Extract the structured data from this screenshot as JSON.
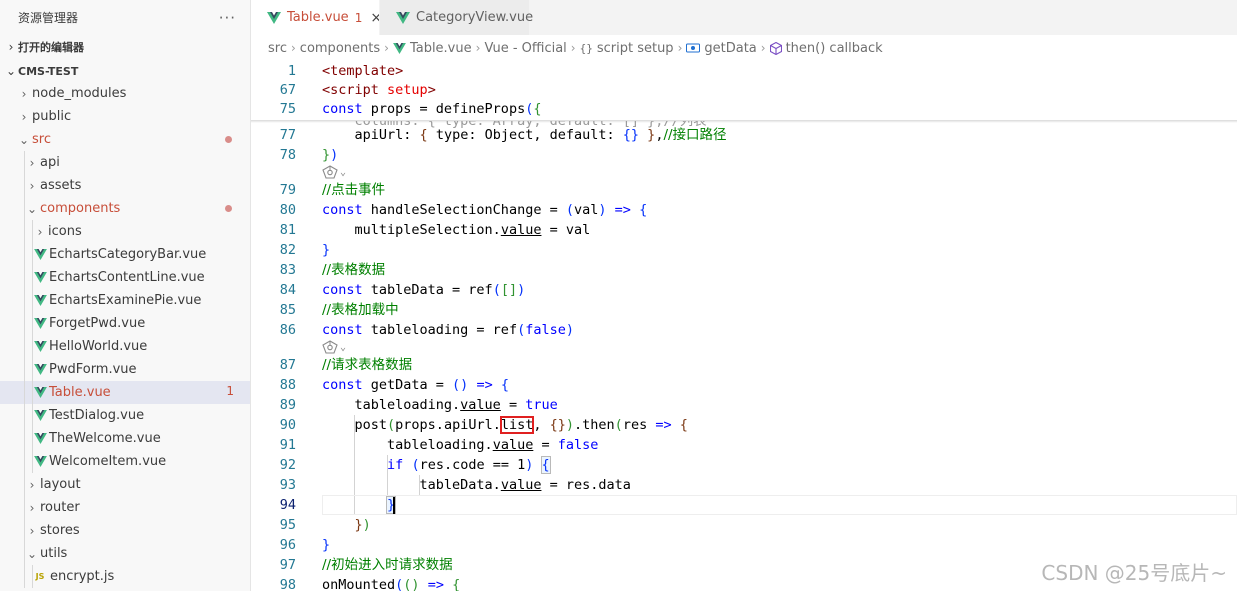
{
  "sidebar": {
    "title": "资源管理器",
    "more": "···",
    "open_editors": "打开的编辑器",
    "project": "CMS-TEST",
    "items": [
      {
        "label": "node_modules",
        "type": "folder",
        "depth": 0,
        "open": false
      },
      {
        "label": "public",
        "type": "folder",
        "depth": 0,
        "open": false
      },
      {
        "label": "src",
        "type": "folder",
        "depth": 0,
        "open": true,
        "modified": true
      },
      {
        "label": "api",
        "type": "folder",
        "depth": 1,
        "open": false
      },
      {
        "label": "assets",
        "type": "folder",
        "depth": 1,
        "open": false
      },
      {
        "label": "components",
        "type": "folder",
        "depth": 1,
        "open": true,
        "modified": true
      },
      {
        "label": "icons",
        "type": "folder",
        "depth": 2,
        "open": false
      },
      {
        "label": "EchartsCategoryBar.vue",
        "type": "vue",
        "depth": 2
      },
      {
        "label": "EchartsContentLine.vue",
        "type": "vue",
        "depth": 2
      },
      {
        "label": "EchartsExaminePie.vue",
        "type": "vue",
        "depth": 2
      },
      {
        "label": "ForgetPwd.vue",
        "type": "vue",
        "depth": 2
      },
      {
        "label": "HelloWorld.vue",
        "type": "vue",
        "depth": 2
      },
      {
        "label": "PwdForm.vue",
        "type": "vue",
        "depth": 2
      },
      {
        "label": "Table.vue",
        "type": "vue",
        "depth": 2,
        "selected": true,
        "modified": true,
        "badge": "1"
      },
      {
        "label": "TestDialog.vue",
        "type": "vue",
        "depth": 2
      },
      {
        "label": "TheWelcome.vue",
        "type": "vue",
        "depth": 2
      },
      {
        "label": "WelcomeItem.vue",
        "type": "vue",
        "depth": 2
      },
      {
        "label": "layout",
        "type": "folder",
        "depth": 1,
        "open": false
      },
      {
        "label": "router",
        "type": "folder",
        "depth": 1,
        "open": false
      },
      {
        "label": "stores",
        "type": "folder",
        "depth": 1,
        "open": false
      },
      {
        "label": "utils",
        "type": "folder",
        "depth": 1,
        "open": true
      },
      {
        "label": "encrypt.js",
        "type": "js",
        "depth": 2
      }
    ]
  },
  "tabs": [
    {
      "label": "Table.vue",
      "badge": "1",
      "close": "×",
      "active": true
    },
    {
      "label": "CategoryView.vue",
      "active": false
    }
  ],
  "breadcrumb": {
    "items": [
      "src",
      "components",
      "Table.vue",
      "Vue - Official",
      "script setup",
      "getData",
      "then() callback"
    ]
  },
  "editor": {
    "ghost_line": "    columns: { type: Array, default: [] },//列表",
    "lines": [
      {
        "num": "1",
        "html": "<span class='tag'>&lt;template&gt;</span>"
      },
      {
        "num": "67",
        "html": "<span class='tag'>&lt;script</span> <span class='attr'>setup</span><span class='tag'>&gt;</span>"
      },
      {
        "num": "75",
        "html": "<span class='kw'>const</span> props = defineProps<span class='br1'>(</span><span class='br2'>{</span>"
      },
      {
        "num": "77",
        "html": "    apiUrl: <span class='br3'>{</span> type: Object, default: <span class='br1'>{}</span> <span class='br3'>}</span>,<span class='cm'>//接口路径</span>"
      },
      {
        "num": "78",
        "html": "<span class='br2'>}</span><span class='br1'>)</span>"
      },
      {
        "num": "79",
        "html": "<span class='cm'>//点击事件</span>"
      },
      {
        "num": "80",
        "html": "<span class='kw'>const</span> handleSelectionChange = <span class='br1'>(</span>val<span class='br1'>)</span> <span class='kw'>=&gt;</span> <span class='br1'>{</span>"
      },
      {
        "num": "81",
        "html": "    multipleSelection.<span class='u'>value</span> = val"
      },
      {
        "num": "82",
        "html": "<span class='br1'>}</span>"
      },
      {
        "num": "83",
        "html": "<span class='cm'>//表格数据</span>"
      },
      {
        "num": "84",
        "html": "<span class='kw'>const</span> tableData = ref<span class='br1'>(</span><span class='br2'>[]</span><span class='br1'>)</span>"
      },
      {
        "num": "85",
        "html": "<span class='cm'>//表格加载中</span>"
      },
      {
        "num": "86",
        "html": "<span class='kw'>const</span> tableloading = ref<span class='br1'>(</span><span class='kw'>false</span><span class='br1'>)</span>"
      },
      {
        "num": "87",
        "html": "<span class='cm'>//请求表格数据</span>"
      },
      {
        "num": "88",
        "html": "<span class='kw'>const</span> getData = <span class='br1'>()</span> <span class='kw'>=&gt;</span> <span class='br1'>{</span>"
      },
      {
        "num": "89",
        "html": "    tableloading.<span class='u'>value</span> = <span class='kw'>true</span>"
      },
      {
        "num": "90",
        "html": "    post<span class='br2'>(</span>props.apiUrl.<span class='hl'>list</span>, <span class='br3'>{}</span><span class='br2'>)</span>.then<span class='br2'>(</span>res <span class='kw'>=&gt;</span> <span class='br3'>{</span>"
      },
      {
        "num": "91",
        "html": "        tableloading.<span class='u'>value</span> = <span class='kw'>false</span>"
      },
      {
        "num": "92",
        "html": "        <span class='kw'>if</span> <span class='br1'>(</span>res.code == 1<span class='br1'>)</span> <span class='bracematch br1'>{</span>"
      },
      {
        "num": "93",
        "html": "            tableData.<span class='u'>value</span> = res.data"
      },
      {
        "num": "94",
        "html": "        <span class='bracematch br1'>}</span>"
      },
      {
        "num": "95",
        "html": "    <span class='br3'>}</span><span class='br2'>)</span>"
      },
      {
        "num": "96",
        "html": "<span class='br1'>}</span>"
      },
      {
        "num": "97",
        "html": "<span class='cm'>//初始进入时请求数据</span>"
      },
      {
        "num": "98",
        "html": "onMounted<span class='br1'>(</span><span class='br2'>()</span> <span class='kw'>=&gt;</span> <span class='br2'>{</span>"
      }
    ]
  },
  "watermark": "CSDN @25号底片~",
  "colors": {
    "vue": "#41b883",
    "vue_dark": "#34495e",
    "modified": "#c74e39"
  }
}
